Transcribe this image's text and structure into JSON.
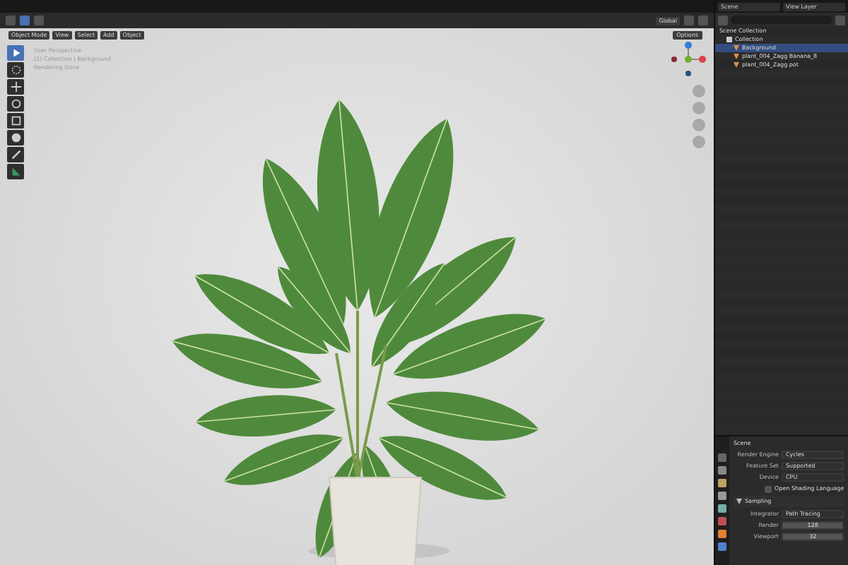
{
  "top_bar": {
    "scene": "Scene",
    "view_layer": "View Layer"
  },
  "viewport_header": {
    "mode": "Object Mode",
    "menus": [
      "View",
      "Select",
      "Add",
      "Object"
    ],
    "orientation": "Global",
    "options": "Options"
  },
  "viewport": {
    "overlay_text": [
      "User Perspective",
      "(1) Collection | Background",
      "Rendering Done"
    ],
    "tools": [
      {
        "kind": "cursor",
        "selected": true
      },
      {
        "kind": "circle",
        "selected": false
      },
      {
        "kind": "move",
        "selected": false
      },
      {
        "kind": "rotate",
        "selected": false
      },
      {
        "kind": "scale",
        "selected": false
      },
      {
        "kind": "transform",
        "selected": false
      },
      {
        "kind": "annotate",
        "selected": false
      },
      {
        "kind": "measure",
        "selected": false
      }
    ]
  },
  "outliner": {
    "root": "Scene Collection",
    "items": [
      {
        "label": "Collection",
        "kind": "collection",
        "selected": false,
        "children": [
          {
            "label": "Background",
            "kind": "object",
            "selected": true
          },
          {
            "label": "plant_004_Zagg Banana_8",
            "kind": "object",
            "selected": false
          },
          {
            "label": "plant_004_Zagg pot",
            "kind": "object",
            "selected": false
          }
        ]
      }
    ]
  },
  "properties": {
    "title": "Scene",
    "fields": [
      {
        "label": "Render Engine",
        "value": "Cycles"
      },
      {
        "label": "Feature Set",
        "value": "Supported"
      },
      {
        "label": "Device",
        "value": "CPU"
      }
    ],
    "checkbox": {
      "label": "Open Shading Language",
      "checked": false
    },
    "section": {
      "label": "Sampling",
      "expanded": true,
      "fields": [
        {
          "label": "Integrator",
          "value": "Path Tracing",
          "kind": "dropdown"
        },
        {
          "label": "Render",
          "value": "128",
          "kind": "number"
        },
        {
          "label": "Viewport",
          "value": "32",
          "kind": "number"
        }
      ]
    }
  }
}
